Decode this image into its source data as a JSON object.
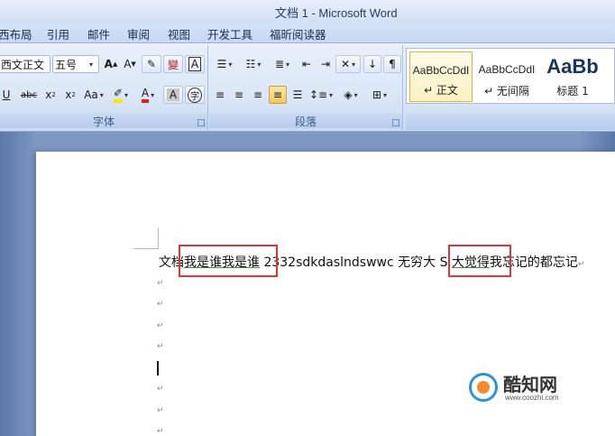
{
  "window": {
    "title": "文档 1 - Microsoft Word"
  },
  "tabs": [
    "西布局",
    "引用",
    "邮件",
    "审阅",
    "视图",
    "开发工具",
    "福昕阅读器"
  ],
  "font_group": {
    "font_name": "西文正文",
    "font_size": "五号",
    "label": "字体"
  },
  "paragraph_group": {
    "label": "段落"
  },
  "styles": [
    {
      "sample": "AaBbCcDdI",
      "name": "↵ 正文",
      "selected": true
    },
    {
      "sample": "AaBbCcDdI",
      "name": "↵ 无间隔",
      "selected": false
    },
    {
      "sample": "AaBb",
      "name": "标题 1",
      "selected": false
    }
  ],
  "document": {
    "line1": {
      "pre": "文档",
      "box1": "我是谁我是谁",
      "mid": " 2332sdkdaslndswwc 无穷大 S ",
      "box2": "大觉得",
      "post": "我忘记的都忘记"
    },
    "para_mark": "↵"
  },
  "watermark": {
    "name": "酷知网",
    "url": "www.coozhi.com"
  },
  "colors": {
    "highlight_box": "#d9363e",
    "ribbon": "#dbe7f7",
    "doc_bg": "#7e98c2"
  }
}
